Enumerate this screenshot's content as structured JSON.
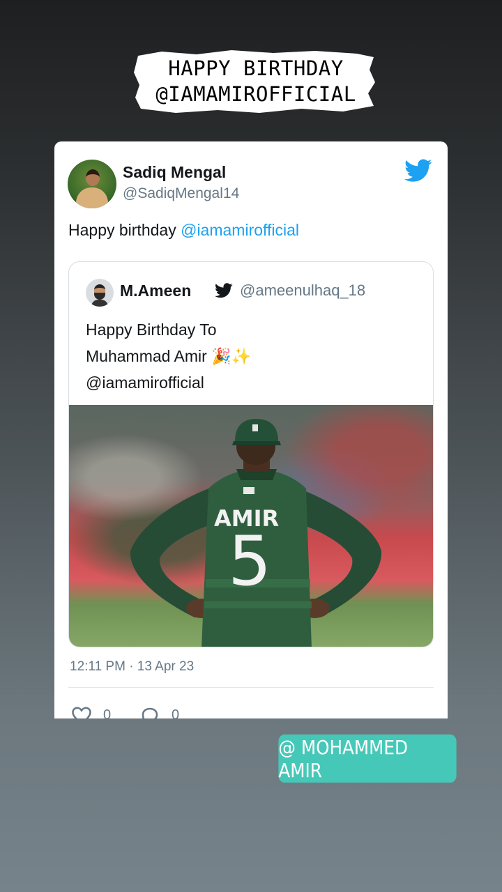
{
  "story": {
    "title_line1": "HAPPY BIRTHDAY",
    "title_line2": "@IAMAMIROFFICIAL",
    "mention_sticker": "@ MOHAMMED AMIR"
  },
  "tweet": {
    "author_name": "Sadiq Mengal",
    "author_handle": "@SadiqMengal14",
    "text_prefix": "Happy birthday ",
    "text_mention": "@iamamirofficial",
    "timestamp": "12:11 PM · 13 Apr 23",
    "like_count": "0",
    "reply_count": "0"
  },
  "quoted_tweet": {
    "author_name": "M.Ameen",
    "author_handle": "@ameenulhaq_18",
    "text_line1": "Happy Birthday To",
    "text_line2": "Muhammad Amir 🎉✨",
    "text_line3": "@iamamirofficial",
    "photo": {
      "jersey_name": "AMIR",
      "jersey_number": "5"
    }
  },
  "colors": {
    "twitter_blue": "#1DA1F2",
    "sticker_teal": "#46C8B8",
    "jersey_green": "#2E5E3E"
  },
  "icons": [
    "twitter-bird-icon",
    "verified-bird-icon",
    "heart-icon",
    "reply-icon"
  ]
}
